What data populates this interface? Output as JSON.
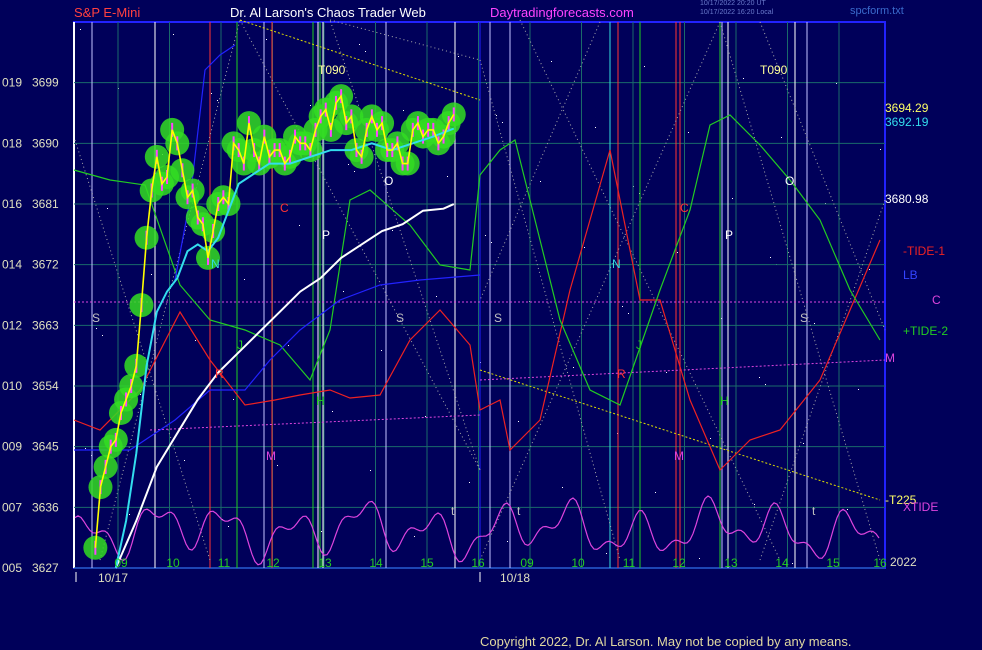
{
  "header": {
    "symbol": "S&P E-Mini",
    "site": "Dr. Al Larson's Chaos Trader Web",
    "url": "Daytradingforecasts.com",
    "file": "spcform.txt",
    "stamp1": "10/17/2022 20:20 UT",
    "stamp2": "10/17/2022 16:20 Local"
  },
  "footer": {
    "copyright": "Copyright 2022, Dr. Al Larson. May not be copied by any means."
  },
  "colors": {
    "background": "#00005a",
    "plot_border": "#2222ff",
    "grid": "#1a6a6a",
    "price": "#ffff00",
    "bar": "#ff44ff",
    "glow": "#33dd22",
    "ma_cyan": "#33ddee",
    "ma_white": "#ffffff",
    "ma_blue": "#2222ff",
    "tide1": "#ee2222",
    "tide2": "#22cc22",
    "magenta": "#dd44dd",
    "trend": "#dddd00"
  },
  "chart_data": {
    "type": "line",
    "ylim": [
      3627,
      3708
    ],
    "xlim": [
      8.7,
      16.5
    ],
    "y_ticks": [
      {
        "left": "019",
        "price": "3699"
      },
      {
        "left": "018",
        "price": "3690"
      },
      {
        "left": "016",
        "price": "3681"
      },
      {
        "left": "014",
        "price": "3672"
      },
      {
        "left": "012",
        "price": "3663"
      },
      {
        "left": "010",
        "price": "3654"
      },
      {
        "left": "009",
        "price": "3645"
      },
      {
        "left": "007",
        "price": "3636"
      },
      {
        "left": "005",
        "price": "3627"
      }
    ],
    "hour_ticks_day1": [
      "09",
      "10",
      "11",
      "12",
      "13",
      "14",
      "15",
      "16"
    ],
    "hour_ticks_day2": [
      "09",
      "10",
      "11",
      "12",
      "13",
      "14",
      "15",
      "16"
    ],
    "dates": [
      "10/17",
      "10/18"
    ],
    "year_label": "2022",
    "value_labels": [
      "3694.29",
      "3692.19",
      "3680.98"
    ],
    "legend": [
      "-TIDE-1",
      "LB",
      "C",
      "+TIDE-2",
      "M",
      "-T225",
      "XTIDE"
    ],
    "series": [
      {
        "name": "price",
        "x": [
          9.0,
          9.1,
          9.2,
          9.3,
          9.4,
          9.5,
          9.6,
          9.7,
          9.8,
          9.9,
          10.0,
          10.1,
          10.2,
          10.3,
          10.4,
          10.5,
          10.6,
          10.7,
          10.8,
          10.9,
          11.0,
          11.1,
          11.2,
          11.3,
          11.4,
          11.5,
          11.6,
          11.7,
          11.8,
          11.9,
          12.0,
          12.1,
          12.2,
          12.3,
          12.4,
          12.5,
          12.6,
          12.7,
          12.8,
          12.9,
          13.0,
          13.1,
          13.2,
          13.3,
          13.4,
          13.5,
          13.6,
          13.7,
          13.8,
          13.9,
          14.0,
          14.1,
          14.2,
          14.3,
          14.4,
          14.5,
          14.6,
          14.7,
          14.8,
          14.9,
          15.0,
          15.1,
          15.2,
          15.3,
          15.4,
          15.5,
          15.6,
          15.7,
          15.8,
          15.9,
          16.0
        ],
        "y": [
          3630,
          3639,
          3642,
          3645,
          3646,
          3650,
          3652,
          3654,
          3657,
          3666,
          3676,
          3683,
          3688,
          3684,
          3685,
          3692,
          3690,
          3686,
          3682,
          3683,
          3679,
          3678,
          3673,
          3677,
          3681,
          3682,
          3681,
          3690,
          3689,
          3687,
          3693,
          3689,
          3687,
          3691,
          3688,
          3689,
          3689,
          3687,
          3688,
          3691,
          3690,
          3690,
          3689,
          3692,
          3694,
          3695,
          3692,
          3696,
          3697,
          3693,
          3694,
          3689,
          3688,
          3692,
          3694,
          3692,
          3693,
          3689,
          3689,
          3690,
          3687,
          3687,
          3692,
          3693,
          3691,
          3692,
          3692,
          3690,
          3691,
          3693,
          3694.29
        ]
      },
      {
        "name": "ma_cyan",
        "x": [
          9.4,
          9.6,
          9.8,
          10.0,
          10.2,
          10.4,
          10.6,
          10.8,
          11.0,
          11.2,
          11.4,
          11.6,
          11.8,
          12.0,
          12.4,
          12.8,
          13.2,
          13.6,
          14.0,
          14.4,
          14.8,
          15.2,
          15.6,
          16.0
        ],
        "y": [
          3627,
          3634,
          3644,
          3657,
          3665,
          3668,
          3670,
          3674,
          3675,
          3674,
          3676,
          3680,
          3684,
          3685,
          3687,
          3687,
          3688,
          3689,
          3689,
          3690,
          3689,
          3690,
          3691,
          3692.19
        ]
      },
      {
        "name": "ma_white",
        "x": [
          9.4,
          9.8,
          10.2,
          10.6,
          11.0,
          11.4,
          11.8,
          12.2,
          12.6,
          13.0,
          13.4,
          13.8,
          14.2,
          14.6,
          15.0,
          15.4,
          15.8,
          16.0
        ],
        "y": [
          3627,
          3634,
          3642,
          3647,
          3652,
          3656,
          3659,
          3662,
          3665,
          3668,
          3670,
          3673,
          3675,
          3677,
          3678,
          3680,
          3680.3,
          3680.98
        ]
      }
    ],
    "indicators": [
      {
        "name": "tide1_red",
        "pts": [
          [
            74,
            420
          ],
          [
            100,
            430
          ],
          [
            140,
            390
          ],
          [
            180,
            312
          ],
          [
            210,
            360
          ],
          [
            245,
            405
          ],
          [
            275,
            400
          ],
          [
            300,
            395
          ],
          [
            330,
            390
          ],
          [
            350,
            398
          ],
          [
            380,
            395
          ],
          [
            410,
            340
          ],
          [
            440,
            310
          ],
          [
            470,
            345
          ],
          [
            480,
            410
          ],
          [
            500,
            400
          ],
          [
            510,
            450
          ],
          [
            540,
            420
          ],
          [
            570,
            290
          ],
          [
            610,
            150
          ],
          [
            640,
            300
          ],
          [
            660,
            300
          ],
          [
            690,
            400
          ],
          [
            720,
            470
          ],
          [
            750,
            440
          ],
          [
            780,
            430
          ],
          [
            820,
            380
          ],
          [
            850,
            310
          ],
          [
            880,
            240
          ]
        ]
      },
      {
        "name": "tide2_green",
        "pts": [
          [
            74,
            170
          ],
          [
            110,
            180
          ],
          [
            145,
            185
          ],
          [
            180,
            285
          ],
          [
            210,
            320
          ],
          [
            245,
            330
          ],
          [
            280,
            345
          ],
          [
            310,
            380
          ],
          [
            330,
            330
          ],
          [
            350,
            200
          ],
          [
            370,
            190
          ],
          [
            410,
            225
          ],
          [
            440,
            265
          ],
          [
            470,
            270
          ],
          [
            480,
            175
          ],
          [
            500,
            150
          ],
          [
            515,
            140
          ],
          [
            540,
            240
          ],
          [
            560,
            320
          ],
          [
            590,
            390
          ],
          [
            620,
            405
          ],
          [
            660,
            290
          ],
          [
            690,
            210
          ],
          [
            710,
            125
          ],
          [
            730,
            115
          ],
          [
            760,
            145
          ],
          [
            790,
            180
          ],
          [
            820,
            220
          ],
          [
            850,
            290
          ],
          [
            880,
            340
          ]
        ]
      },
      {
        "name": "lb_blue",
        "pts": [
          [
            74,
            450
          ],
          [
            130,
            450
          ],
          [
            175,
            420
          ],
          [
            210,
            390
          ],
          [
            245,
            390
          ],
          [
            270,
            360
          ],
          [
            300,
            330
          ],
          [
            340,
            300
          ],
          [
            380,
            285
          ],
          [
            420,
            280
          ],
          [
            480,
            275
          ]
        ]
      },
      {
        "name": "blue_upper",
        "pts": [
          [
            175,
            280
          ],
          [
            190,
            200
          ],
          [
            205,
            70
          ],
          [
            220,
            55
          ],
          [
            235,
            45
          ]
        ]
      },
      {
        "name": "magenta_bottom",
        "pts": []
      },
      {
        "name": "trend1",
        "pts": [
          [
            240,
            20
          ],
          [
            480,
            100
          ]
        ]
      },
      {
        "name": "trend2",
        "pts": [
          [
            480,
            370
          ],
          [
            880,
            500
          ]
        ]
      }
    ]
  },
  "markers": [
    {
      "t": "S",
      "c": "#c0c0c0"
    },
    {
      "t": "S",
      "c": "#c0c0c0"
    },
    {
      "t": "S",
      "c": "#c0c0c0"
    },
    {
      "t": "S",
      "c": "#c0c0c0"
    },
    {
      "t": "N",
      "c": "#33dddd"
    },
    {
      "t": "N",
      "c": "#33dddd"
    },
    {
      "t": "R",
      "c": "#ff3333"
    },
    {
      "t": "R",
      "c": "#ff3333"
    },
    {
      "t": "C",
      "c": "#ff3333"
    },
    {
      "t": "C",
      "c": "#ff3333"
    },
    {
      "t": "M",
      "c": "#dd44dd"
    },
    {
      "t": "M",
      "c": "#dd44dd"
    },
    {
      "t": "J",
      "c": "#22cc22"
    },
    {
      "t": "J",
      "c": "#22cc22"
    },
    {
      "t": "H",
      "c": "#22cc22"
    },
    {
      "t": "H",
      "c": "#22cc22"
    },
    {
      "t": "P",
      "c": "#ffffff"
    },
    {
      "t": "P",
      "c": "#ffffff"
    },
    {
      "t": "O",
      "c": "#ffffff"
    },
    {
      "t": "O",
      "c": "#ffffff"
    },
    {
      "t": "T090",
      "c": "#ffff99"
    },
    {
      "t": "T090",
      "c": "#ffff99"
    },
    {
      "t": "t",
      "c": "#c0c0c0"
    },
    {
      "t": "t",
      "c": "#c0c0c0"
    },
    {
      "t": "t",
      "c": "#c0c0c0"
    }
  ]
}
